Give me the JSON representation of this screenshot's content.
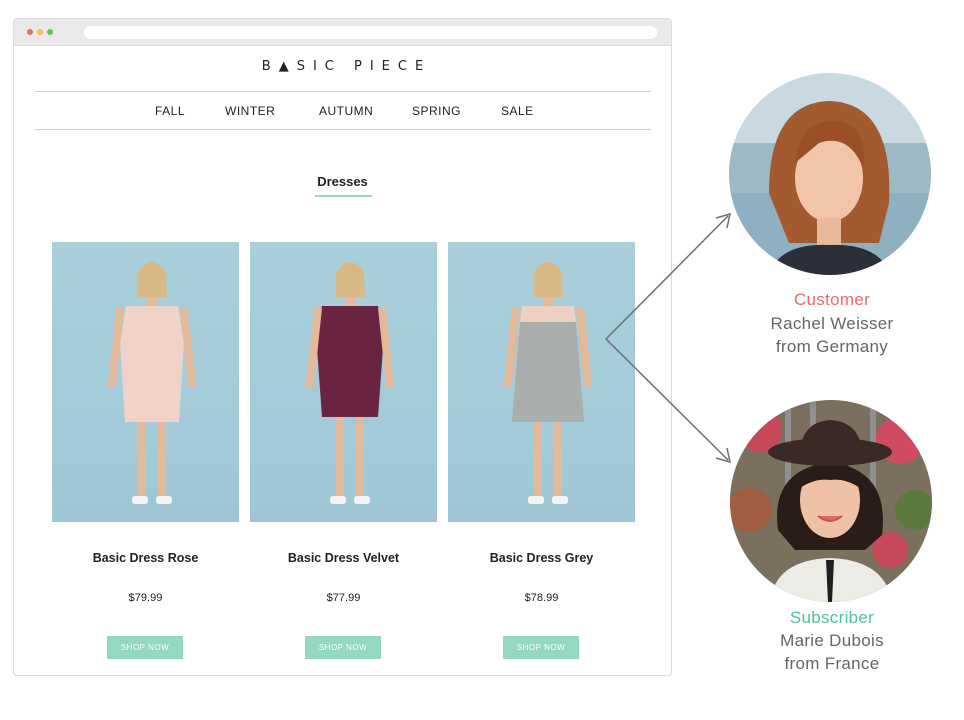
{
  "store": {
    "logo": "B▲SIC PIECE",
    "nav": [
      "FALL",
      "WINTER",
      "AUTUMN",
      "SPRING",
      "SALE"
    ],
    "section_title": "Dresses"
  },
  "products": [
    {
      "name": "Basic Dress Rose",
      "price": "$79.99",
      "button": "SHOP NOW",
      "dress_color": "#f0d2c8"
    },
    {
      "name": "Basic Dress Velvet",
      "price": "$77.99",
      "button": "SHOP NOW",
      "dress_color": "#6a2340"
    },
    {
      "name": "Basic Dress Grey",
      "price": "$78.99",
      "button": "SHOP NOW",
      "dress_color": "#a9adab"
    }
  ],
  "personas": [
    {
      "type": "Customer",
      "name": "Rachel Weisser",
      "origin": "from Germany",
      "type_color": "#f0666a"
    },
    {
      "type": "Subscriber",
      "name": "Marie Dubois",
      "origin": "from France",
      "type_color": "#4cc49a"
    }
  ],
  "colors": {
    "accent": "#94d8c0",
    "customer": "#f0666a",
    "subscriber": "#4cc49a"
  }
}
